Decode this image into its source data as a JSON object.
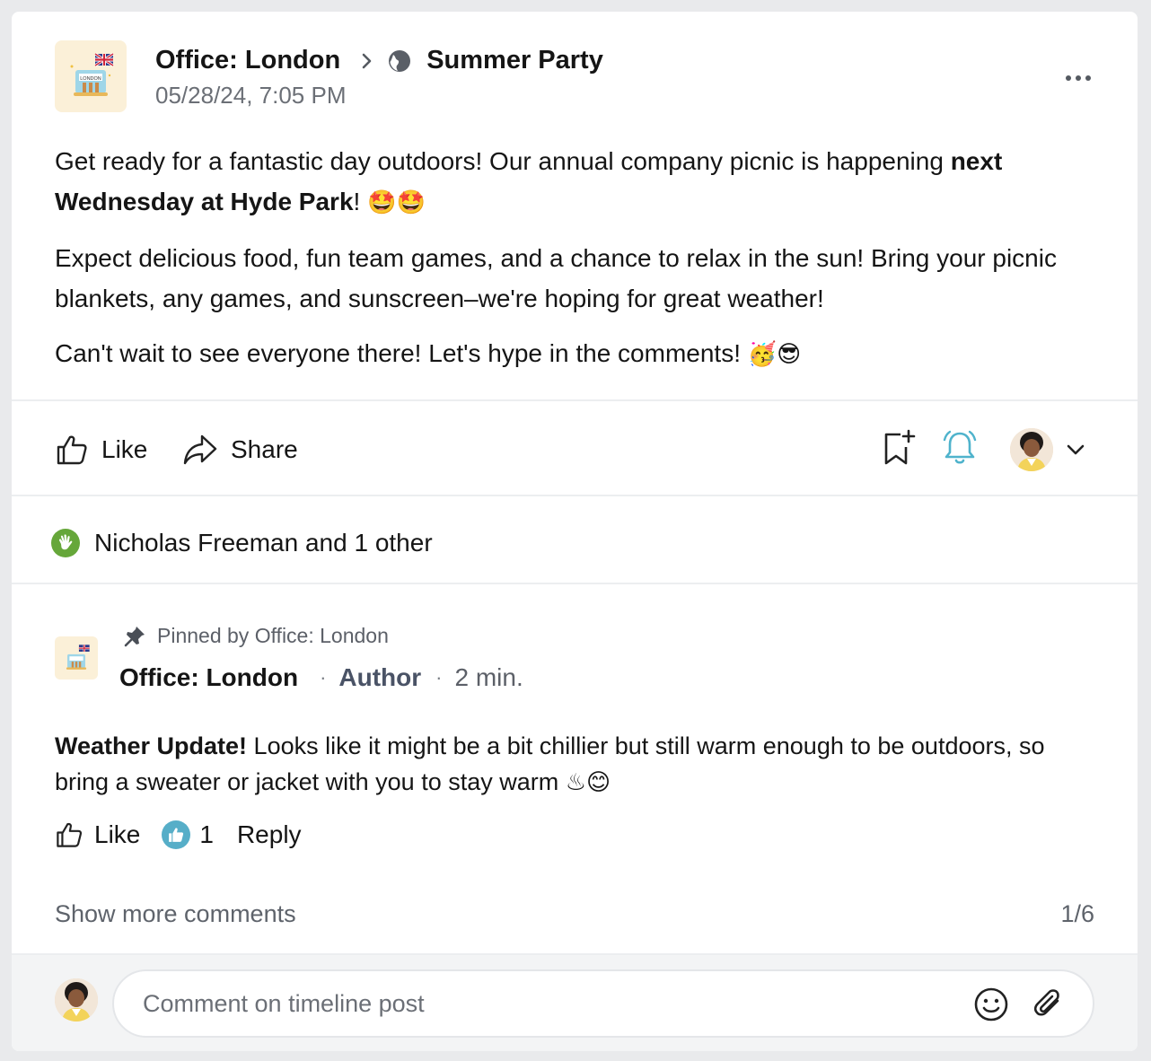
{
  "header": {
    "group_name": "Office: London",
    "event_name": "Summer Party",
    "timestamp": "05/28/24, 7:05 PM",
    "logo_text": "LONDON"
  },
  "post": {
    "p1_text": "Get ready for a fantastic day outdoors! Our annual company picnic is happening ",
    "p1_bold": "next Wednesday at Hyde Park",
    "p1_end": "!",
    "p1_emoji": "🤩🤩",
    "p2_text": "Expect delicious food, fun team games, and a chance to relax in the sun! Bring your picnic blankets, any games, and sunscreen–we're hoping for great weather!",
    "p3_text": "Can't wait to see everyone there! Let's hype in the comments! ",
    "p3_emoji": "🥳😎"
  },
  "actions": {
    "like_label": "Like",
    "share_label": "Share"
  },
  "reactions": {
    "summary": "Nicholas Freeman and 1 other"
  },
  "comment": {
    "pinned_label": "Pinned by Office: London",
    "author": "Office: London",
    "role": "Author",
    "time": "2 min.",
    "bold_text": "Weather Update!",
    "text": " Looks like it might be a bit chillier but still warm enough to be outdoors, so bring a sweater or jacket with you to stay warm ",
    "emoji": "♨😊",
    "like_label": "Like",
    "like_count": "1",
    "reply_label": "Reply"
  },
  "footer": {
    "show_more_label": "Show more comments",
    "pager": "1/6",
    "composer_placeholder": "Comment on timeline post"
  },
  "colors": {
    "bell_accent": "#4fb3cc",
    "reaction_green": "#66a73a",
    "like_blue": "#56aec8"
  }
}
